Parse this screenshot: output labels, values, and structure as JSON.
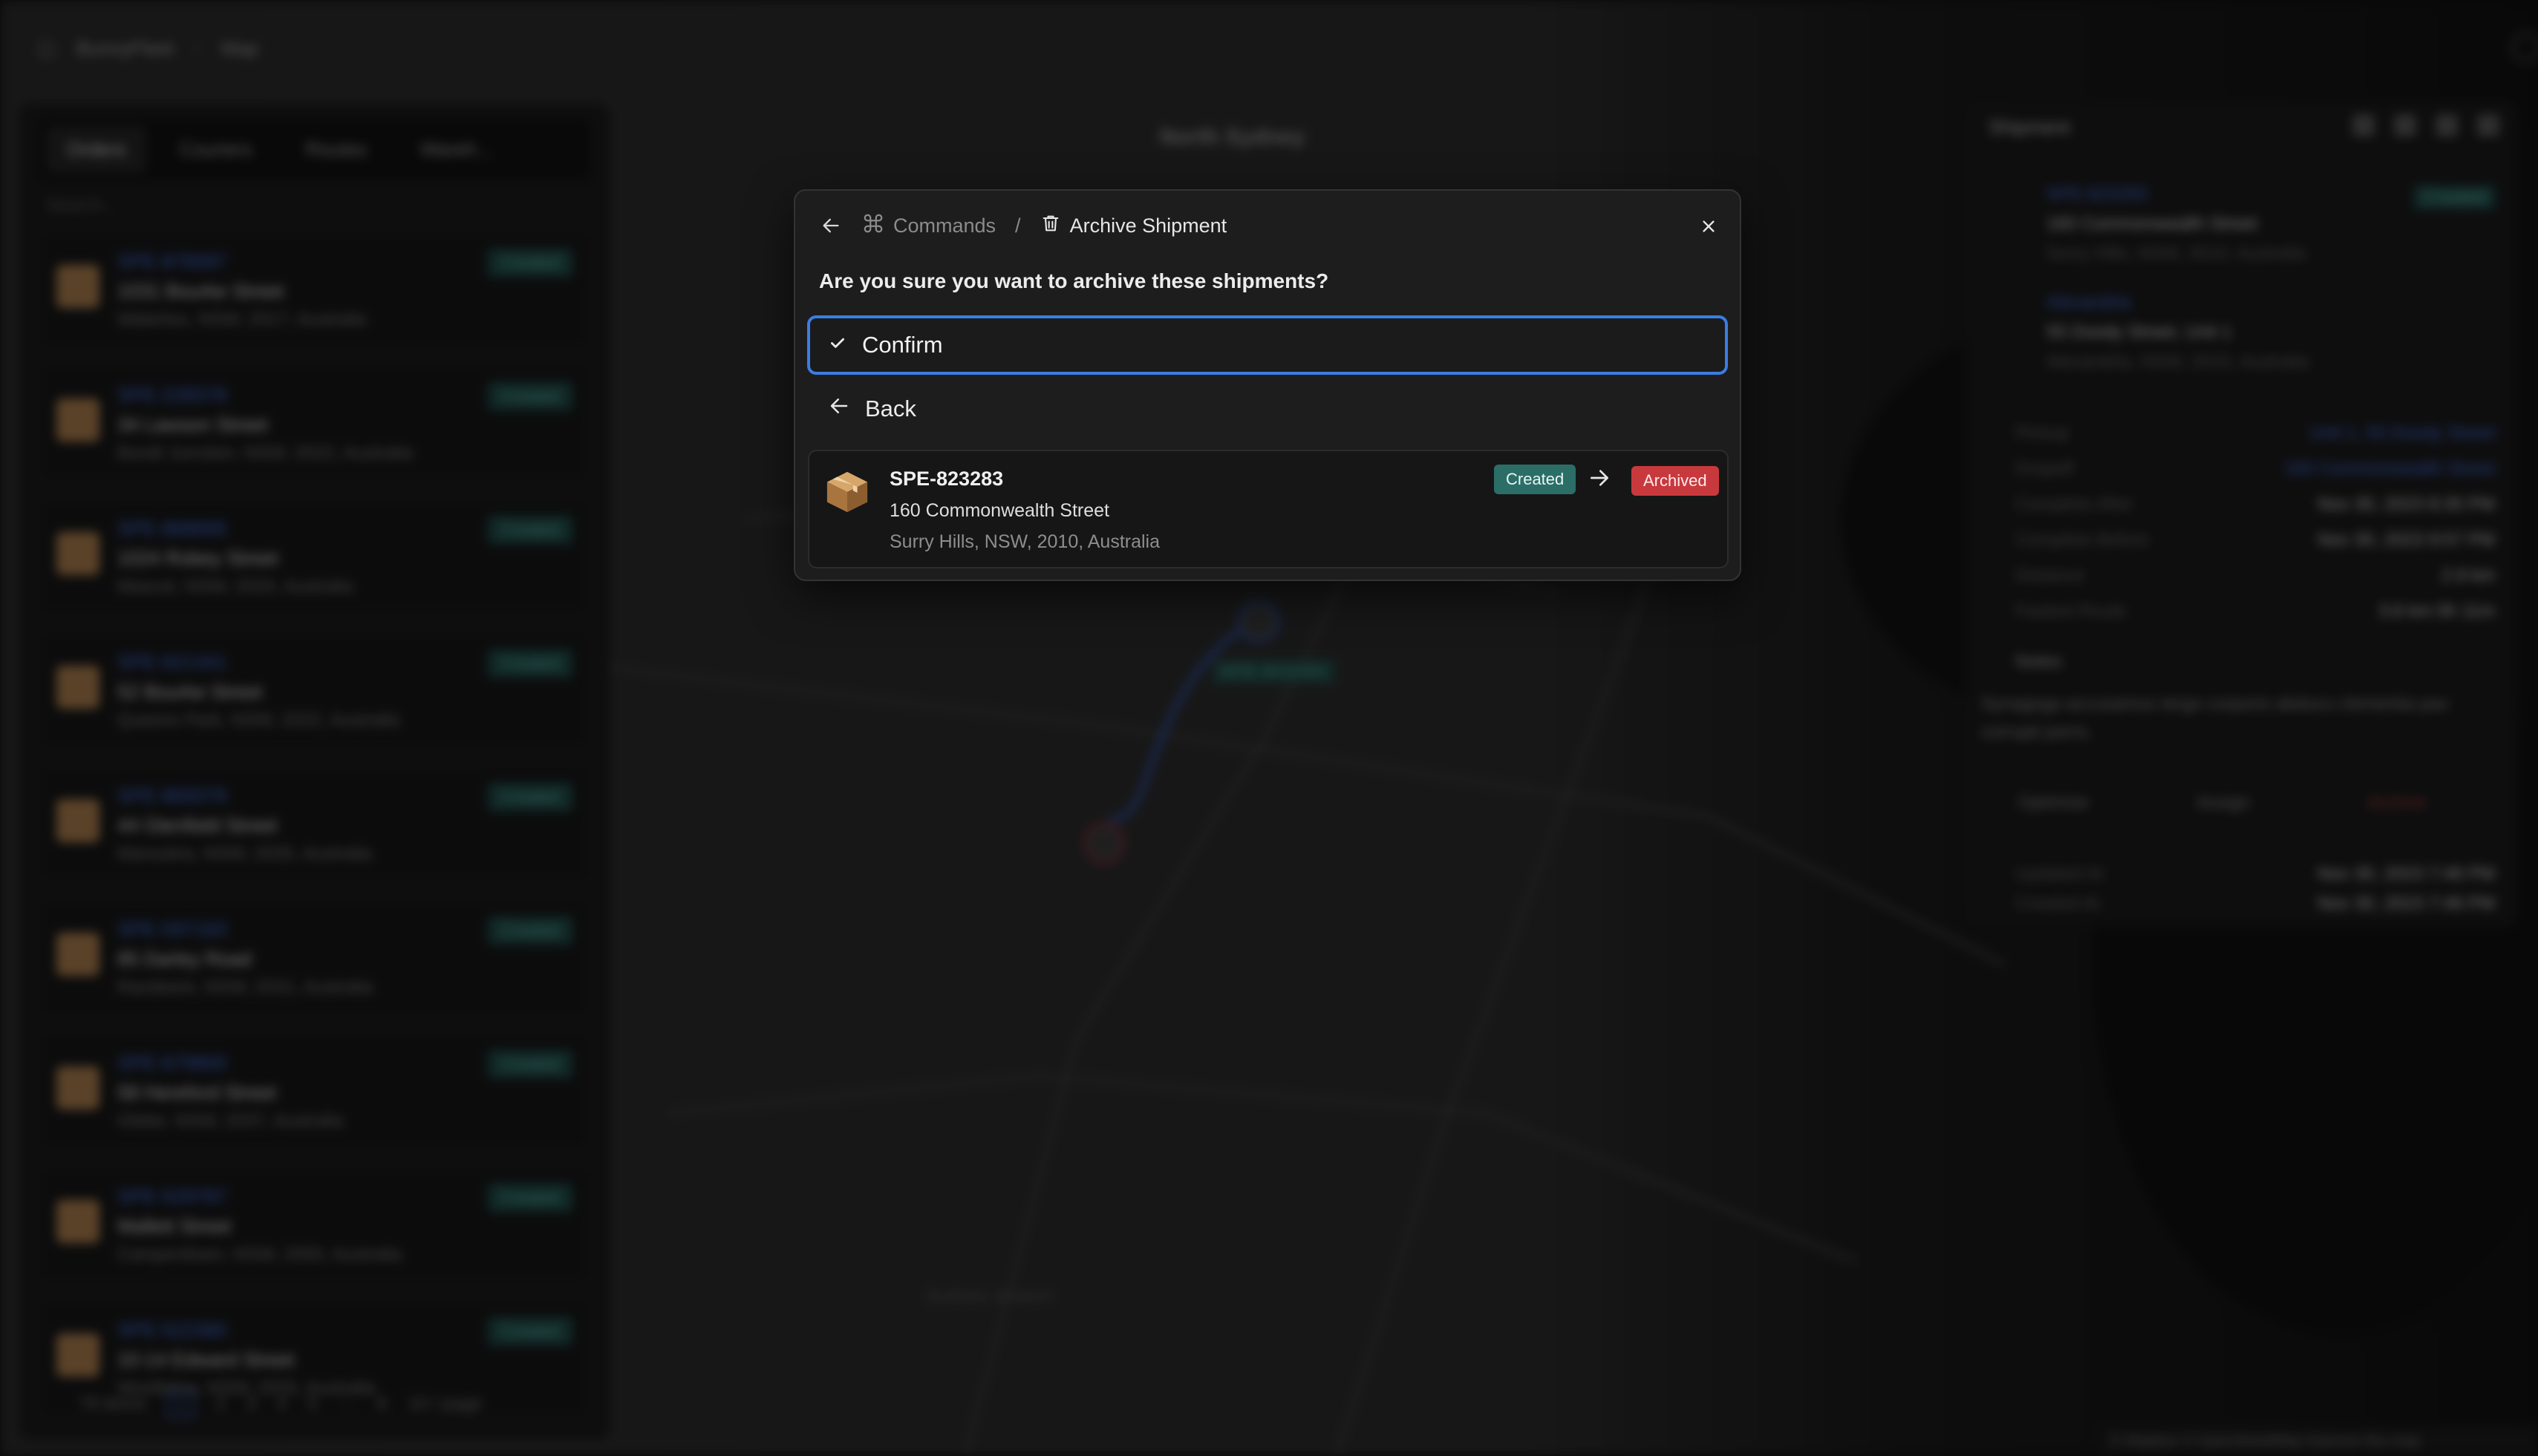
{
  "topbar": {
    "app_name": "BunnyFleet",
    "section": "Map"
  },
  "left_panel": {
    "tabs": [
      "Orders",
      "Couriers",
      "Routes",
      "Wareh..."
    ],
    "search_placeholder": "Search...",
    "orders": [
      {
        "id": "SPE-878087",
        "street": "1031 Bourke Street",
        "address": "Waterloo, NSW, 2017, Australia",
        "status": "Created"
      },
      {
        "id": "SPE-228378",
        "street": "34 Lawson Street",
        "address": "Bondi Junction, NSW, 2022, Australia",
        "status": "Created"
      },
      {
        "id": "SPE-868695",
        "street": "1024 Robey Street",
        "address": "Mascot, NSW, 2020, Australia",
        "status": "Created"
      },
      {
        "id": "SPE-921341",
        "street": "52 Bourke Street",
        "address": "Queens Park, NSW, 2022, Australia",
        "status": "Created"
      },
      {
        "id": "SPE-865078",
        "street": "44 Glenfield Street",
        "address": "Maroubra, NSW, 2035, Australia",
        "status": "Created"
      },
      {
        "id": "SPE-597183",
        "street": "85 Darley Road",
        "address": "Randwick, NSW, 2031, Australia",
        "status": "Created"
      },
      {
        "id": "SPE-679800",
        "street": "58 Hereford Street",
        "address": "Glebe, NSW, 2037, Australia",
        "status": "Created"
      },
      {
        "id": "SPE-529787",
        "street": "Mallett Street",
        "address": "Camperdown, NSW, 2050, Australia",
        "status": "Created"
      },
      {
        "id": "SPE-522380",
        "street": "10-14 Edward Street",
        "address": "Woollahra, NSW, 2025, Australia",
        "status": "Created"
      }
    ],
    "pager": {
      "total": "79 items",
      "pages": [
        "1",
        "2",
        "3",
        "4",
        "5",
        "···",
        "8"
      ],
      "page_size": "10 / page"
    }
  },
  "map": {
    "labels": [
      "North Sydney",
      "Sydney Airport"
    ],
    "route_label": "SPE-823283",
    "attribution": "© Mapbox © OpenStreetMap Improve this map"
  },
  "right_panel": {
    "title": "Shipment",
    "shipment_id": "SPE-823283",
    "street": "160 Commonwealth Street",
    "address": "Surry Hills, NSW, 2010, Australia",
    "status": "Created",
    "warehouse": "Alexandria",
    "warehouse_street": "55 Doody Street, Unit 1",
    "warehouse_address": "Alexandria, NSW, 2015, Australia",
    "rows": [
      {
        "label": "Pickup",
        "value": "Unit 1, 55 Doody Street"
      },
      {
        "label": "Dropoff",
        "value": "160 Commonwealth Street"
      },
      {
        "label": "Complete After",
        "value": "Nov 30, 2023 8:35 PM"
      },
      {
        "label": "Complete Before",
        "value": "Nov 30, 2023 9:57 PM"
      },
      {
        "label": "Distance",
        "value": "2.9 km"
      },
      {
        "label": "Fastest Route",
        "value": "3.6 km  0h 11m"
      }
    ],
    "notes_title": "Notes",
    "notes": "Synagoga accusamus tergo corporis abduco clementia pax corrupti porro.",
    "actions": [
      "Optimize",
      "Assign",
      "Archive"
    ],
    "updated_label": "Updated At",
    "updated_value": "Nov 30, 2023 7:46 PM",
    "created_label": "Created At",
    "created_value": "Nov 30, 2023 7:46 PM"
  },
  "dialog": {
    "breadcrumb_root": "Commands",
    "breadcrumb_current": "Archive Shipment",
    "question": "Are you sure you want to archive these shipments?",
    "confirm_label": "Confirm",
    "back_label": "Back",
    "shipment": {
      "id": "SPE-823283",
      "street": "160 Commonwealth Street",
      "address": "Surry Hills, NSW, 2010, Australia",
      "status_from": "Created",
      "status_to": "Archived"
    }
  },
  "colors": {
    "accent": "#3b7de3",
    "created_badge": "#2b6e68",
    "archived_badge": "#c8393d",
    "dialog_bg": "#1d1d1e"
  },
  "icons": [
    "back-arrow-icon",
    "command-icon",
    "trash-icon",
    "close-icon",
    "check-icon",
    "arrow-left-icon",
    "package-icon",
    "arrow-right-icon"
  ]
}
